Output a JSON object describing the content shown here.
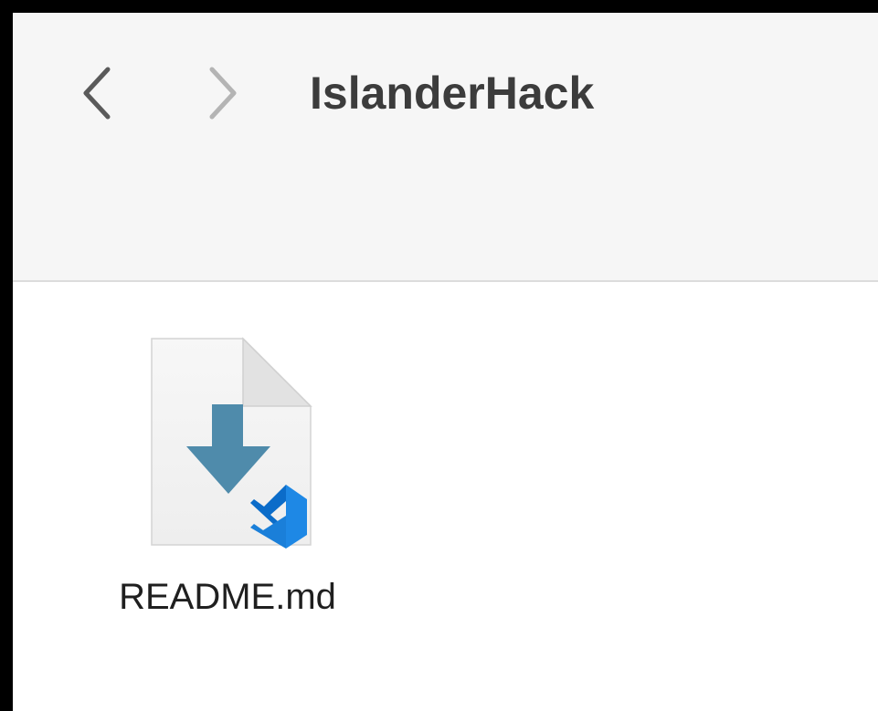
{
  "window": {
    "title": "IslanderHack"
  },
  "toolbar": {
    "back_icon": "chevron-left-icon",
    "forward_icon": "chevron-right-icon"
  },
  "files": [
    {
      "name": "README.md",
      "icon": "markdown-file-icon",
      "badge_icon": "vscode-icon"
    }
  ],
  "colors": {
    "markdown_arrow": "#4f8bab",
    "vscode_blue": "#1e88e5",
    "title_text": "#3c3c3c",
    "toolbar_bg": "#f6f6f6"
  }
}
